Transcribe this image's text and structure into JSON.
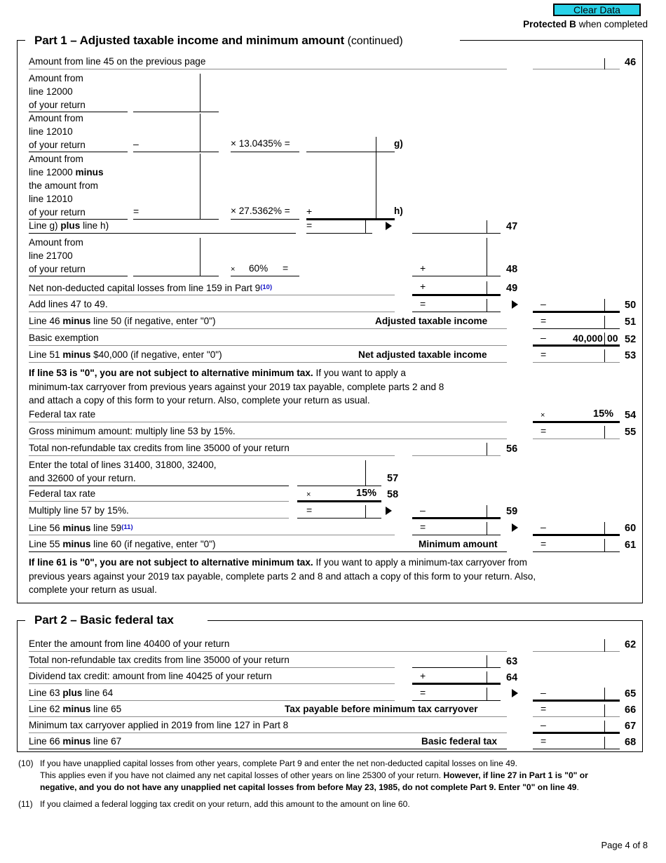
{
  "header": {
    "clear_data_label": "Clear Data",
    "protected_bold": "Protected B",
    "protected_rest": " when completed"
  },
  "part1": {
    "title_bold": "Part 1 – Adjusted taxable income and minimum amount ",
    "title_light": "(continued)",
    "rows": {
      "r46": {
        "label": "Amount from line 45 on the previous page",
        "number": "46"
      },
      "block12000": {
        "l1": "Amount from",
        "l2": "line 12000",
        "l3": "of your return"
      },
      "block12010": {
        "l1": "Amount from",
        "l2": "line 12010",
        "l3": "of your return",
        "op": "–",
        "factor": "×  13.0435%  =",
        "tag": "g)"
      },
      "block12000minus": {
        "l1": "Amount from",
        "l2a": "line 12000 ",
        "l2b": "minus",
        "l3": "the amount from",
        "l4": "line 12010",
        "l5": "of your return",
        "op": "=",
        "factor": "×  27.5362%  =",
        "plus": "+",
        "tag": "h)"
      },
      "r47": {
        "label_a": "Line g) ",
        "label_b": "plus",
        "label_c": " line h)",
        "eq": "=",
        "number": "47"
      },
      "r48": {
        "l1": "Amount from",
        "l2": "line 21700",
        "l3": "of your return",
        "factor_x": "×",
        "factor": "60%",
        "eq": "=",
        "plus": "+",
        "number": "48"
      },
      "r49": {
        "label": "Net non-deducted capital losses from line 159 in Part 9",
        "footnote": "(10)",
        "plus": "+",
        "number": "49"
      },
      "r50": {
        "label": "Add lines 47 to 49.",
        "eq": "=",
        "minus": "–",
        "number": "50"
      },
      "r51": {
        "label_a": "Line 46 ",
        "label_b": "minus",
        "label_c": " line 50 (if negative, enter \"0\")",
        "caption": "Adjusted taxable income",
        "eq": "=",
        "number": "51"
      },
      "r52": {
        "label": "Basic exemption",
        "minus": "–",
        "value": "40,000",
        "cents": "00",
        "number": "52"
      },
      "r53": {
        "label_a": "Line 51 ",
        "label_b": "minus",
        "label_c": " $40,000 (if negative, enter \"0\")",
        "caption": "Net adjusted taxable income",
        "eq": "=",
        "number": "53"
      },
      "r54": {
        "label": "Federal tax rate",
        "op": "×",
        "value": "15%",
        "number": "54"
      },
      "r55": {
        "label": "Gross minimum amount: multiply line 53 by 15%.",
        "eq": "=",
        "number": "55"
      },
      "r56": {
        "label": "Total non-refundable tax credits from line 35000 of your return",
        "number": "56"
      },
      "r57": {
        "l1": "Enter the total of lines 31400, 31800, 32400,",
        "l2": "and 32600 of your return.",
        "number": "57"
      },
      "r58": {
        "label": "Federal tax rate",
        "op": "×",
        "value": "15%",
        "number": "58"
      },
      "r59": {
        "label": "Multiply line 57 by 15%.",
        "eq": "=",
        "minus": "–",
        "number": "59"
      },
      "r60": {
        "label_a": "Line 56 ",
        "label_b": "minus",
        "label_c": " line 59",
        "footnote": "(11)",
        "eq": "=",
        "minus": "–",
        "number": "60"
      },
      "r61": {
        "label_a": "Line 55 ",
        "label_b": "minus",
        "label_c": " line 60 (if negative, enter \"0\")",
        "caption": "Minimum amount",
        "eq": "=",
        "number": "61"
      }
    },
    "note53": {
      "bold": "If line 53 is \"0\", you are not subject to alternative minimum tax.",
      "rest_l1": " If you want to apply a",
      "l2": "minimum-tax carryover from previous years against your 2019 tax payable, complete parts 2 and 8",
      "l3": "and attach a copy of this form to your return. Also, complete your return as usual."
    },
    "note61": {
      "bold": "If line 61 is \"0\", you are not subject to alternative minimum tax.",
      "rest_l1": " If you want to apply a minimum-tax carryover from",
      "l2": "previous years against your 2019 tax payable, complete parts 2 and 8 and attach a copy of this form to your return. Also,",
      "l3": "complete your return as usual."
    }
  },
  "part2": {
    "title_bold": "Part 2 – Basic federal tax",
    "rows": {
      "r62": {
        "label": "Enter the amount from line 40400 of your return",
        "number": "62"
      },
      "r63": {
        "label": "Total non-refundable tax credits from line 35000 of your return",
        "number": "63"
      },
      "r64": {
        "label": "Dividend tax credit: amount from line 40425 of your return",
        "plus": "+",
        "number": "64"
      },
      "r65": {
        "label_a": "Line 63 ",
        "label_b": "plus",
        "label_c": " line 64",
        "eq": "=",
        "minus": "–",
        "number": "65"
      },
      "r66": {
        "label_a": "Line 62 ",
        "label_b": "minus",
        "label_c": " line 65",
        "caption": "Tax payable before minimum tax carryover",
        "eq": "=",
        "number": "66"
      },
      "r67": {
        "label": "Minimum tax carryover applied in 2019 from line 127 in Part 8",
        "minus": "–",
        "number": "67"
      },
      "r68": {
        "label_a": "Line 66 ",
        "label_b": "minus",
        "label_c": " line 67",
        "caption": "Basic federal tax",
        "eq": "=",
        "number": "68"
      }
    }
  },
  "footnotes": {
    "f10_marker": "(10)",
    "f10_l1": "If you have unapplied capital losses from other years, complete Part 9 and enter the net non-deducted capital losses on line 49.",
    "f10_l2a": "This applies even if you have not claimed any net capital losses of other years on line 25300 of your return. ",
    "f10_l2b": "However, if line 27 in Part 1 is \"0\" or",
    "f10_l3b": "negative, and you do not have any unapplied net capital losses",
    "f10_l3c": " from before May 23, 1985, ",
    "f10_l3d": "do not complete Part 9. Enter \"0\" on line 49",
    "f10_l3e": ".",
    "f11_marker": "(11)",
    "f11_l1": "If you claimed a federal logging tax credit on your return, add this amount to the amount on line 60."
  },
  "footer": {
    "page_label": "Page 4 of 8"
  }
}
